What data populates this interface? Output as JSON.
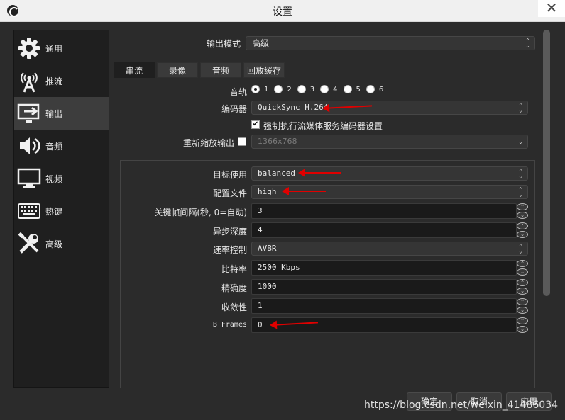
{
  "window": {
    "title": "设置",
    "close": "✕"
  },
  "sidebar": {
    "items": [
      {
        "label": "通用",
        "icon": "gear-icon"
      },
      {
        "label": "推流",
        "icon": "broadcast-antenna-icon"
      },
      {
        "label": "输出",
        "icon": "output-monitor-icon",
        "active": true
      },
      {
        "label": "音频",
        "icon": "speaker-icon"
      },
      {
        "label": "视频",
        "icon": "monitor-icon"
      },
      {
        "label": "热键",
        "icon": "keyboard-icon"
      },
      {
        "label": "高级",
        "icon": "tools-icon"
      }
    ]
  },
  "output_mode": {
    "label": "输出模式",
    "value": "高级"
  },
  "tabs": [
    "串流",
    "录像",
    "音频",
    "回放缓存"
  ],
  "audio_track": {
    "label": "音轨",
    "options": [
      "1",
      "2",
      "3",
      "4",
      "5",
      "6"
    ],
    "selected": "1"
  },
  "encoder": {
    "label": "编码器",
    "value": "QuickSync H.264"
  },
  "enforce_encoder": {
    "label": "强制执行流媒体服务编码器设置",
    "checked": true
  },
  "rescale": {
    "label": "重新缩放输出",
    "value": "1366x768",
    "checked": false
  },
  "settings": {
    "target_usage": {
      "label": "目标使用",
      "value": "balanced"
    },
    "profile": {
      "label": "配置文件",
      "value": "high"
    },
    "keyframe": {
      "label": "关键帧间隔(秒, 0=自动)",
      "value": "3"
    },
    "async_depth": {
      "label": "异步深度",
      "value": "4"
    },
    "rate_control": {
      "label": "速率控制",
      "value": "AVBR"
    },
    "bitrate": {
      "label": "比特率",
      "value": "2500 Kbps"
    },
    "accuracy": {
      "label": "精确度",
      "value": "1000"
    },
    "convergence": {
      "label": "收敛性",
      "value": "1"
    },
    "bframes": {
      "label": "B Frames",
      "value": "0"
    }
  },
  "footer": {
    "ok": "确定",
    "cancel": "取消",
    "apply": "应用"
  },
  "watermark": "https://blog.csdn.net/weixin_41486034",
  "colors": {
    "background": "#2b2b2b",
    "sidebar": "#1f1f1f",
    "active": "#3d3d3d",
    "annotation_arrow": "#e00000"
  }
}
